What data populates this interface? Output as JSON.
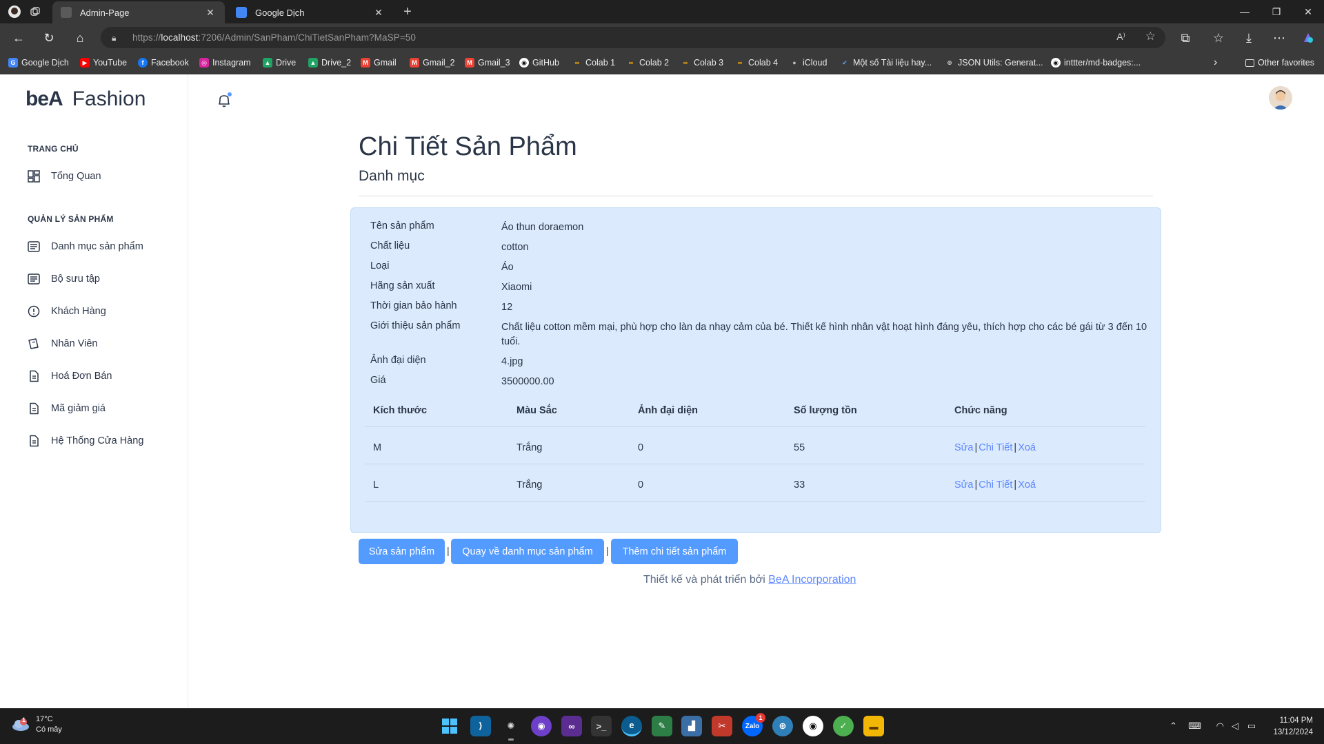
{
  "browser": {
    "tabs": [
      {
        "title": "Admin-Page",
        "active": true
      },
      {
        "title": "Google Dịch",
        "active": false
      }
    ],
    "url": {
      "scheme": "https://",
      "host": "localhost",
      "rest": ":7206/Admin/SanPham/ChiTietSanPham?MaSP=50"
    },
    "bookmarks": [
      {
        "label": "Google Dịch",
        "icon": "google-translate-icon",
        "color": "#4285f4"
      },
      {
        "label": "YouTube",
        "icon": "youtube-icon",
        "color": "#ff0000"
      },
      {
        "label": "Facebook",
        "icon": "facebook-icon",
        "color": "#1877f2"
      },
      {
        "label": "Instagram",
        "icon": "instagram-icon",
        "color": "#d6249f"
      },
      {
        "label": "Drive",
        "icon": "drive-icon",
        "color": "#1fa463"
      },
      {
        "label": "Drive_2",
        "icon": "drive-icon",
        "color": "#1fa463"
      },
      {
        "label": "Gmail",
        "icon": "gmail-icon",
        "color": "#ea4335"
      },
      {
        "label": "Gmail_2",
        "icon": "gmail-icon",
        "color": "#ea4335"
      },
      {
        "label": "Gmail_3",
        "icon": "gmail-icon",
        "color": "#ea4335"
      },
      {
        "label": "GitHub",
        "icon": "github-icon",
        "color": "#ffffff"
      },
      {
        "label": "Colab 1",
        "icon": "colab-icon",
        "color": "#f9ab00"
      },
      {
        "label": "Colab 2",
        "icon": "colab-icon",
        "color": "#f9ab00"
      },
      {
        "label": "Colab 3",
        "icon": "colab-icon",
        "color": "#f9ab00"
      },
      {
        "label": "Colab 4",
        "icon": "colab-icon",
        "color": "#f9ab00"
      },
      {
        "label": "iCloud",
        "icon": "apple-icon",
        "color": "#bbbbbb"
      },
      {
        "label": "Một số Tài liệu hay...",
        "icon": "bookmark-icon",
        "color": "#5fa8ff"
      },
      {
        "label": "JSON Utils: Generat...",
        "icon": "globe-icon",
        "color": "#cccccc"
      },
      {
        "label": "inttter/md-badges:...",
        "icon": "github-icon",
        "color": "#ffffff"
      }
    ],
    "other_favorites": "Other favorites"
  },
  "sidebar": {
    "logo_mark": "beA",
    "logo_text": "Fashion",
    "sections": [
      {
        "heading": "TRANG CHỦ",
        "items": [
          {
            "label": "Tổng Quan",
            "icon": "dashboard-icon"
          }
        ]
      },
      {
        "heading": "QUẢN LÝ SẢN PHẨM",
        "items": [
          {
            "label": "Danh mục sản phẩm",
            "icon": "article-icon"
          },
          {
            "label": "Bộ sưu tập",
            "icon": "article-icon"
          },
          {
            "label": "Khách Hàng",
            "icon": "alert-circle-icon"
          },
          {
            "label": "Nhân Viên",
            "icon": "cards-icon"
          },
          {
            "label": "Hoá Đơn Bán",
            "icon": "file-text-icon"
          },
          {
            "label": "Mã giảm giá",
            "icon": "file-text-icon"
          },
          {
            "label": "Hệ Thống Cửa Hàng",
            "icon": "file-text-icon"
          }
        ]
      }
    ]
  },
  "main": {
    "title": "Chi Tiết Sản Phẩm",
    "subtitle": "Danh mục",
    "details": [
      {
        "label": "Tên sản phẩm",
        "value": "Áo thun doraemon"
      },
      {
        "label": "Chất liệu",
        "value": "cotton"
      },
      {
        "label": "Loại",
        "value": "Áo"
      },
      {
        "label": "Hãng sản xuất",
        "value": "Xiaomi"
      },
      {
        "label": "Thời gian bảo hành",
        "value": "12"
      },
      {
        "label": "Giới thiệu sản phẩm",
        "value": "Chất liệu cotton mềm mại, phù hợp cho làn da nhạy cảm của bé. Thiết kế hình nhân vật hoạt hình đáng yêu, thích hợp cho các bé gái từ 3 đến 10 tuổi."
      },
      {
        "label": "Ảnh đại diện",
        "value": "4.jpg"
      },
      {
        "label": "Giá",
        "value": "3500000.00"
      }
    ],
    "variants_table": {
      "headers": [
        "Kích thước",
        "Màu Sắc",
        "Ảnh đại diện",
        "Số lượng tồn",
        "Chức năng"
      ],
      "rows": [
        {
          "size": "M",
          "color": "Trắng",
          "image": "0",
          "stock": "55"
        },
        {
          "size": "L",
          "color": "Trắng",
          "image": "0",
          "stock": "33"
        }
      ],
      "actions": {
        "edit": "Sửa",
        "detail": "Chi Tiết",
        "delete": "Xoá",
        "separator": "|"
      }
    },
    "buttons": {
      "edit_product": "Sửa sản phẩm",
      "back_to_list": "Quay về danh mục sản phẩm",
      "add_detail": "Thêm chi tiết sản phẩm",
      "separator": "|"
    },
    "footer": {
      "text": "Thiết kế và phát triển bởi ",
      "link": "BeA Incorporation"
    }
  },
  "taskbar": {
    "weather": {
      "temp": "17°C",
      "desc": "Có mây",
      "badge": "1"
    },
    "apps": [
      "windows-start-icon",
      "vscode-icon",
      "chatgpt-icon",
      "github-desktop-icon",
      "visual-studio-icon",
      "terminal-icon",
      "edge-icon",
      "paint-icon",
      "monitor-icon",
      "snip-icon",
      "zalo-icon",
      "globe-icon",
      "github-icon",
      "app-green-icon",
      "file-explorer-icon"
    ],
    "zalo_badge": "1",
    "time": "11:04 PM",
    "date": "13/12/2024"
  },
  "colors": {
    "accent": "#539bff",
    "link": "#5d87ff",
    "panel": "#dbeafc",
    "text": "#2a3547"
  }
}
